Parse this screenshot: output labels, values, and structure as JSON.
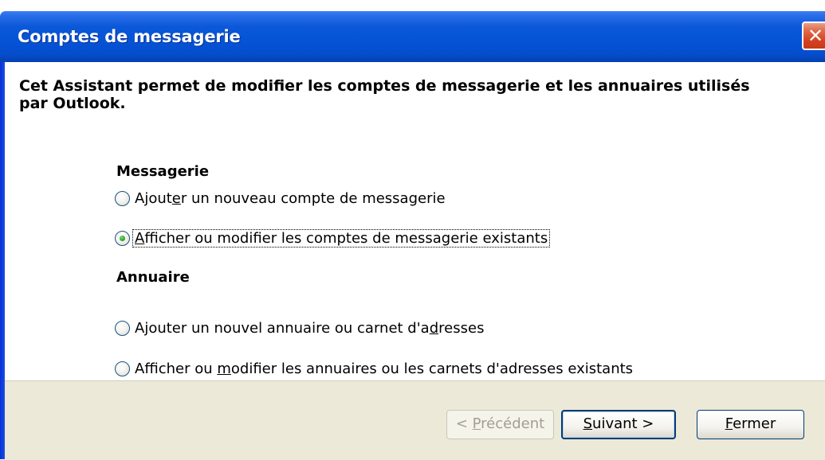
{
  "window": {
    "title": "Comptes de messagerie",
    "close_glyph": "✕"
  },
  "intro": "Cet Assistant permet de modifier les comptes de messagerie et les annuaires utilisés par Outlook.",
  "sections": {
    "messagerie": {
      "title": "Messagerie",
      "options": [
        {
          "pre": "Ajout",
          "u": "e",
          "post": "r un nouveau compte de messagerie",
          "checked": false
        },
        {
          "pre": "",
          "u": "A",
          "post": "fficher ou modifier les comptes de messagerie existants",
          "checked": true
        }
      ]
    },
    "annuaire": {
      "title": "Annuaire",
      "options": [
        {
          "pre": "Ajouter un nouvel annuaire ou carnet d'a",
          "u": "d",
          "post": "resses",
          "checked": false
        },
        {
          "pre": "Afficher ou ",
          "u": "m",
          "post": "odifier les annuaires ou les carnets d'adresses existants",
          "checked": false
        }
      ]
    }
  },
  "buttons": {
    "back": {
      "pre": "< ",
      "u": "P",
      "post": "récédent",
      "enabled": false
    },
    "next": {
      "pre": "",
      "u": "S",
      "post": "uivant >",
      "enabled": true
    },
    "close": {
      "pre": "",
      "u": "F",
      "post": "ermer",
      "enabled": true
    }
  },
  "colors": {
    "titlebar": "#0553d6",
    "close_button": "#d3411f",
    "button_bar": "#ece9d8",
    "radio_selected": "#29a229"
  },
  "icons": [
    "close-icon",
    "radio-icon"
  ]
}
